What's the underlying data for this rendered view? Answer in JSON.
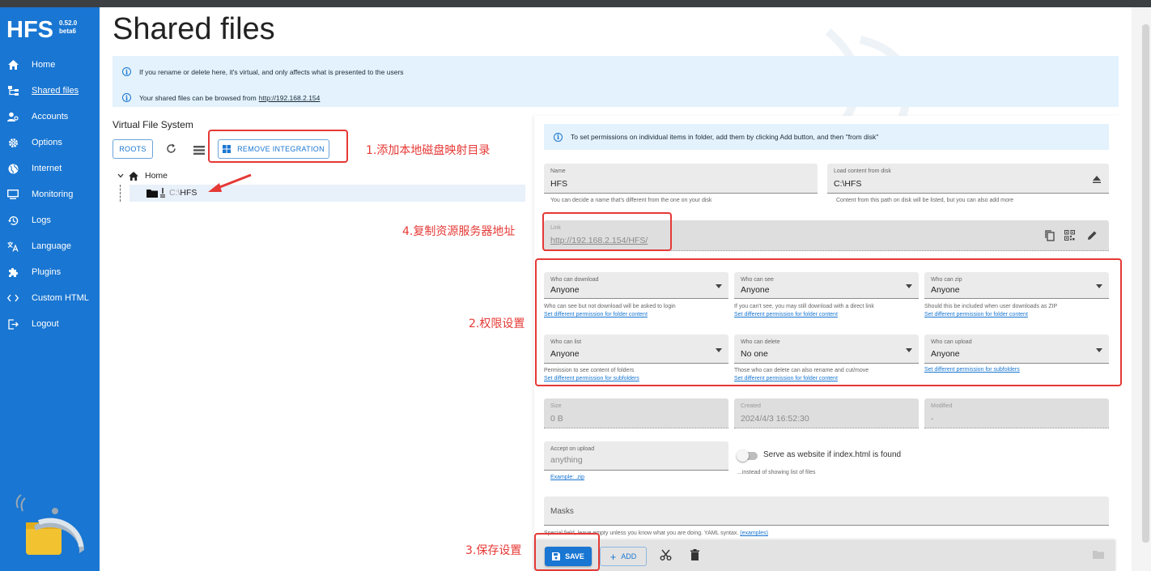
{
  "app": {
    "logo": "HFS",
    "version_line1": "0.52.0",
    "version_line2": "beta6"
  },
  "sidebar": {
    "items": [
      {
        "label": "Home",
        "icon": "home-icon"
      },
      {
        "label": "Shared files",
        "icon": "tree-icon",
        "active": true
      },
      {
        "label": "Accounts",
        "icon": "accounts-icon"
      },
      {
        "label": "Options",
        "icon": "gear-icon"
      },
      {
        "label": "Internet",
        "icon": "globe-icon"
      },
      {
        "label": "Monitoring",
        "icon": "monitor-icon"
      },
      {
        "label": "Logs",
        "icon": "history-icon"
      },
      {
        "label": "Language",
        "icon": "translate-icon"
      },
      {
        "label": "Plugins",
        "icon": "puzzle-icon"
      },
      {
        "label": "Custom HTML",
        "icon": "code-icon"
      },
      {
        "label": "Logout",
        "icon": "logout-icon"
      }
    ]
  },
  "page": {
    "title": "Shared files",
    "info1": "If you rename or delete here, it's virtual, and only affects what is presented to the users",
    "info2_prefix": "Your shared files can be browsed from",
    "info2_link": "http://192.168.2.154"
  },
  "vfs": {
    "title": "Virtual File System",
    "roots_label": "ROOTS",
    "remove_integration_label": "REMOVE INTEGRATION",
    "tree": {
      "root_label": "Home",
      "child_prefix": "C:\\",
      "child_label": "HFS"
    }
  },
  "form": {
    "info": "To set permissions on individual items in folder, add them by clicking Add button, and then \"from disk\"",
    "name": {
      "label": "Name",
      "value": "HFS",
      "helper": "You can decide a name that's different from the one on your disk"
    },
    "source": {
      "label": "Load content from disk",
      "value": "C:\\HFS",
      "helper": "Content from this path on disk will be listed, but you can also add more"
    },
    "link": {
      "label": "Link",
      "value": "http://192.168.2.154/HFS/"
    },
    "perms": [
      {
        "label": "Who can download",
        "value": "Anyone",
        "helper": "Who can see but not download will be asked to login",
        "link": "Set different permission for folder content"
      },
      {
        "label": "Who can see",
        "value": "Anyone",
        "helper": "If you can't see, you may still download with a direct link",
        "link": "Set different permission for folder content"
      },
      {
        "label": "Who can zip",
        "value": "Anyone",
        "helper": "Should this be included when user downloads as ZIP",
        "link": "Set different permission for folder content"
      },
      {
        "label": "Who can list",
        "value": "Anyone",
        "helper": "Permission to see content of folders",
        "link": "Set different permission for subfolders"
      },
      {
        "label": "Who can delete",
        "value": "No one",
        "helper": "Those who can delete can also rename and cut/move",
        "link": "Set different permission for folder content"
      },
      {
        "label": "Who can upload",
        "value": "Anyone",
        "helper": "",
        "link": "Set different permission for subfolders"
      }
    ],
    "size": {
      "label": "Size",
      "value": "0 B"
    },
    "created": {
      "label": "Created",
      "value": "2024/4/3 16:52:30"
    },
    "modified": {
      "label": "Modified",
      "value": "-"
    },
    "accept": {
      "label": "Accept on upload",
      "placeholder": "anything",
      "example": "Example: .zip"
    },
    "website": {
      "label": "Serve as website if index.html is found",
      "helper": "...instead of showing list of files"
    },
    "masks": {
      "label": "Masks",
      "helper": "Special field, leave empty unless you know what you are doing. YAML syntax.",
      "helper_link": "(examples)"
    },
    "save_label": "SAVE",
    "add_label": "ADD"
  },
  "annotations": {
    "a1": "1.添加本地磁盘映射目录",
    "a2": "2.权限设置",
    "a3": "3.保存设置",
    "a4": "4.复制资源服务器地址"
  },
  "colors": {
    "primary": "#1976d2",
    "annotation": "#e53935",
    "info_bg": "#e3f2fc"
  }
}
